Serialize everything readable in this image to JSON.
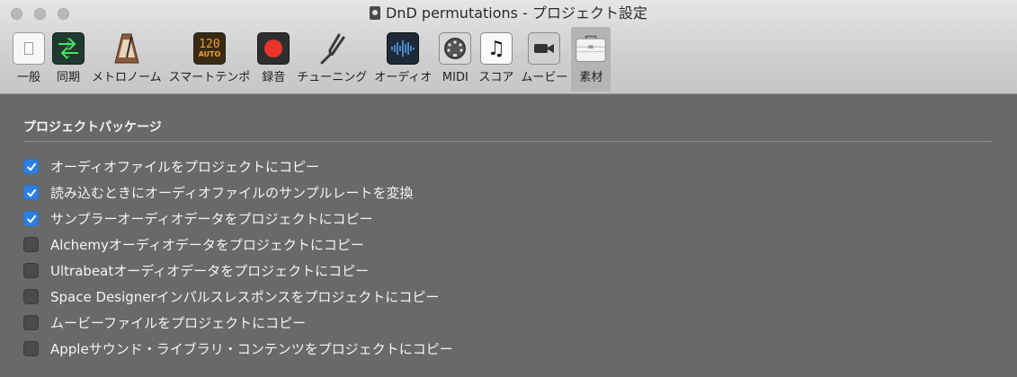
{
  "window": {
    "title": "DnD permutations - プロジェクト設定",
    "doc_icon": "logic-document-icon"
  },
  "toolbar": {
    "items": [
      {
        "label": "一般",
        "icon": "general-switch-icon"
      },
      {
        "label": "同期",
        "icon": "sync-arrows-icon"
      },
      {
        "label": "メトロノーム",
        "icon": "metronome-icon"
      },
      {
        "label": "スマートテンポ",
        "icon": "smart-tempo-icon",
        "display_number": "120",
        "display_mode": "AUTO"
      },
      {
        "label": "録音",
        "icon": "record-icon"
      },
      {
        "label": "チューニング",
        "icon": "tuning-fork-icon"
      },
      {
        "label": "オーディオ",
        "icon": "audio-waveform-icon"
      },
      {
        "label": "MIDI",
        "icon": "midi-port-icon"
      },
      {
        "label": "スコア",
        "icon": "score-note-icon"
      },
      {
        "label": "ムービー",
        "icon": "movie-camera-icon"
      },
      {
        "label": "素材",
        "icon": "briefcase-icon",
        "selected": true
      }
    ]
  },
  "section": {
    "title": "プロジェクトパッケージ"
  },
  "options": [
    {
      "label": "オーディオファイルをプロジェクトにコピー",
      "checked": true
    },
    {
      "label": "読み込むときにオーディオファイルのサンプルレートを変換",
      "checked": true
    },
    {
      "label": "サンプラーオーディオデータをプロジェクトにコピー",
      "checked": true
    },
    {
      "label": "Alchemyオーディオデータをプロジェクトにコピー",
      "checked": false
    },
    {
      "label": "Ultrabeatオーディオデータをプロジェクトにコピー",
      "checked": false
    },
    {
      "label": "Space Designerインパルスレスポンスをプロジェクトにコピー",
      "checked": false
    },
    {
      "label": "ムービーファイルをプロジェクトにコピー",
      "checked": false
    },
    {
      "label": "Appleサウンド・ライブラリ・コンテンツをプロジェクトにコピー",
      "checked": false
    }
  ],
  "colors": {
    "checkbox_on": "#2d7fe3",
    "panel_bg": "#696969",
    "record_red": "#e8342a"
  }
}
